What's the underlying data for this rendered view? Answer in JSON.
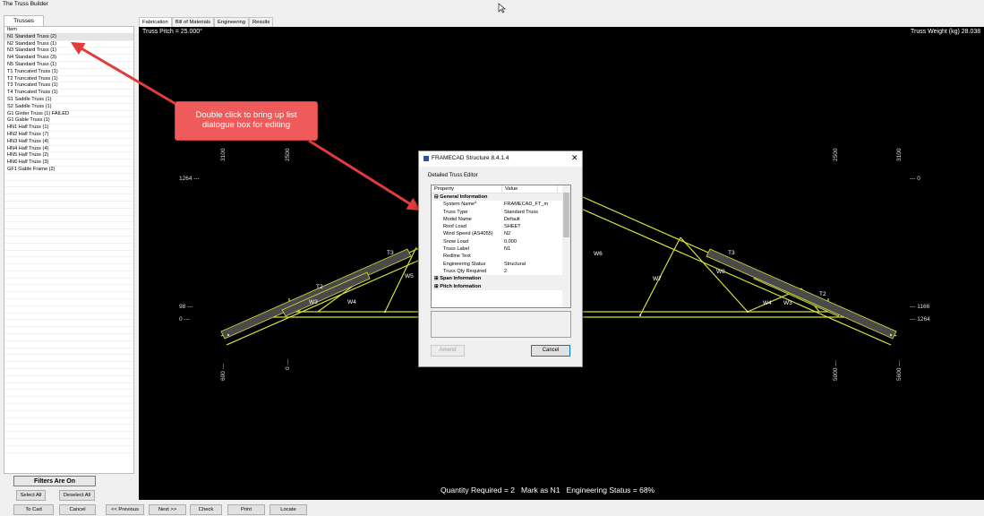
{
  "app_title": "The Truss Builder",
  "left_panel": {
    "tab": "Trusses",
    "header": "Item",
    "items": [
      "N1 Standard Truss (2)",
      "N2 Standard Truss (1)",
      "N3 Standard Truss (1)",
      "N4 Standard Truss (3)",
      "N5 Standard Truss (1)",
      "T1 Truncated Truss (1)",
      "T2 Truncated Truss (1)",
      "T3 Truncated Truss (1)",
      "T4 Truncated Truss (1)",
      "S1 Saddle Truss (1)",
      "S2 Saddle Truss (1)",
      "G1 Girder Truss (1) FAILED",
      "G1 Gable Truss (1)",
      "HN1 Half Truss (1)",
      "HN2 Half Truss (7)",
      "HN3 Half Truss (4)",
      "HN4 Half Truss (4)",
      "HN5 Half Truss (2)",
      "HN6 Half Truss (3)",
      "GF1 Gable Frame (2)"
    ],
    "filters_label": "Filters Are On",
    "select_all": "Select All",
    "deselect_all": "Deselect All"
  },
  "bottom_buttons": {
    "to_cad": "To Cad",
    "cancel": "Cancel",
    "previous": "<< Previous",
    "next": "Next >>",
    "check": "Check",
    "print": "Print",
    "locate": "Locate"
  },
  "tabs": [
    "Fabrication",
    "Bill of Materials",
    "Engineering",
    "Results"
  ],
  "canvas": {
    "pitch": "Truss Pitch = 25.000°",
    "weight": "Truss Weight (kg) 28.038",
    "dims_left": [
      "1264 ---",
      "98 ---",
      "0 ---"
    ],
    "dims_right": [
      "--- 0",
      "--- 1166",
      "--- 1264"
    ],
    "dims_top": [
      "3100",
      "2500",
      "2500",
      "3100"
    ],
    "dims_bottom": [
      "600 ---",
      "0 ---",
      "5000 ---",
      "5600 ---"
    ],
    "member_labels": [
      "T3",
      "T2",
      "W3",
      "W4",
      "W5",
      "W6",
      "W7",
      "W8",
      "T3",
      "T2",
      "W3",
      "W4"
    ],
    "status": {
      "qty": "Quantity Required = 2",
      "mark": "Mark as N1",
      "eng": "Engineering Status = 68%"
    }
  },
  "callout": {
    "line1": "Double click to bring up list",
    "line2": "dialogue box for editing"
  },
  "dialog": {
    "title": "FRAMECAD Structure 8.4.1.4",
    "subtitle": "Detailed Truss Editor",
    "col_property": "Property",
    "col_value": "Value",
    "category_general": "General Information",
    "rows": [
      {
        "p": "System Name*",
        "v": "FRAMECAD_FT_m"
      },
      {
        "p": "Truss Type",
        "v": "Standard Truss"
      },
      {
        "p": "Model Name",
        "v": "Default"
      },
      {
        "p": "Roof Load",
        "v": "SHEET"
      },
      {
        "p": "Wind Speed (AS4055)",
        "v": "N2"
      },
      {
        "p": "Snow Load",
        "v": "0.000"
      },
      {
        "p": "Truss Label",
        "v": "N1"
      },
      {
        "p": "Redline Text",
        "v": ""
      },
      {
        "p": "Engineering Status",
        "v": "Structural"
      },
      {
        "p": "Truss Qty Required",
        "v": "2"
      }
    ],
    "category_span": "Span Information",
    "category_pitch": "Pitch Information",
    "amend": "Amend",
    "cancel": "Cancel"
  },
  "colors": {
    "member": "#d7e03a",
    "canvas_bg": "#000000",
    "callout": "#ef5a5a",
    "arrow": "#e23b3b"
  }
}
